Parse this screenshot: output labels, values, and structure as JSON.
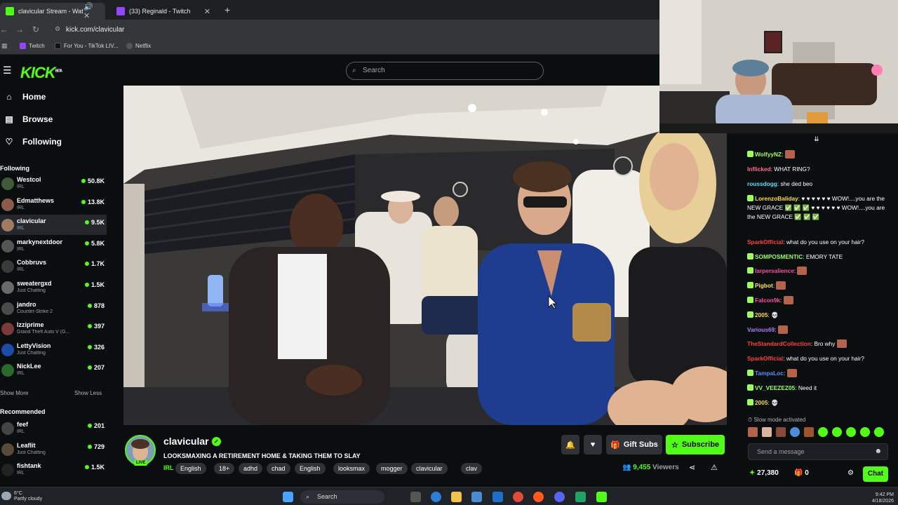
{
  "browser": {
    "tabs": [
      {
        "title": "clavicular Stream - Watch L",
        "color": "#53fc18"
      },
      {
        "title": "(33) Reginald - Twitch",
        "color": "#9146ff"
      }
    ],
    "url": "kick.com/clavicular",
    "bookmarks": [
      {
        "label": "Twitch",
        "color": "#9146ff"
      },
      {
        "label": "For You - TikTok LIV...",
        "color": "#222"
      },
      {
        "label": "Netflix",
        "color": "#666"
      }
    ]
  },
  "kick": {
    "logo": "KICK",
    "logo_sup": "BETA",
    "search_placeholder": "Search"
  },
  "sidebar": {
    "nav": [
      {
        "label": "Home",
        "icon": "home-icon"
      },
      {
        "label": "Browse",
        "icon": "browse-icon"
      },
      {
        "label": "Following",
        "icon": "heart-icon"
      }
    ],
    "following_heading": "Following",
    "following": [
      {
        "name": "Westcol",
        "category": "IRL",
        "viewers": "50.8K",
        "color": "#3e5c3a"
      },
      {
        "name": "Edmatthews",
        "category": "IRL",
        "viewers": "13.8K",
        "color": "#8a5a4a"
      },
      {
        "name": "clavicular",
        "category": "IRL",
        "viewers": "9.5K",
        "color": "#a07b62"
      },
      {
        "name": "markynextdoor",
        "category": "IRL",
        "viewers": "5.8K",
        "color": "#555"
      },
      {
        "name": "Cobbruvs",
        "category": "IRL",
        "viewers": "1.7K",
        "color": "#3a3a3a"
      },
      {
        "name": "sweatergxd",
        "category": "Just Chatting",
        "viewers": "1.5K",
        "color": "#6a6a6a"
      },
      {
        "name": "jandro",
        "category": "Counter-Strike 2",
        "viewers": "878",
        "color": "#4a4a4a"
      },
      {
        "name": "Izziprime",
        "category": "Grand Theft Auto V (G...",
        "viewers": "397",
        "color": "#7a3a3a"
      },
      {
        "name": "LettyVision",
        "category": "Just Chatting",
        "viewers": "326",
        "color": "#1f4aa8"
      },
      {
        "name": "NickLee",
        "category": "IRL",
        "viewers": "207",
        "color": "#2a6a2a"
      }
    ],
    "show_more": "Show More",
    "show_less": "Show Less",
    "recommended_heading": "Recommended",
    "recommended": [
      {
        "name": "feef",
        "category": "IRL",
        "viewers": "201",
        "color": "#444"
      },
      {
        "name": "Leaflit",
        "category": "Just Chatting",
        "viewers": "729",
        "color": "#5a4a3a"
      },
      {
        "name": "fishtank",
        "category": "IRL",
        "viewers": "1.5K",
        "color": "#222"
      }
    ]
  },
  "stream": {
    "streamer": "clavicular",
    "live_label": "LIVE",
    "title": "LOOKSMAXING A RETIREMENT HOME & TAKING THEM TO SLAY",
    "category": "IRL",
    "tags": [
      "English",
      "18+",
      "adhd",
      "chad",
      "English",
      "looksmax",
      "mogger",
      "clavicular",
      "clav"
    ],
    "gift_subs": "Gift Subs",
    "subscribe": "Subscribe",
    "viewers": "9,455",
    "viewers_label": "Viewers"
  },
  "chat": {
    "messages": [
      {
        "user": "WolfyyNZ",
        "color": "#9dff5c",
        "text": "",
        "emote": true
      },
      {
        "user": "Inflicked",
        "color": "#ff6b8a",
        "text": "WHAT RING?"
      },
      {
        "user": "roussdogg",
        "color": "#5ce1ff",
        "text": "she ded beo"
      },
      {
        "user": "LorenzoBaliday",
        "color": "#ffd94a",
        "text": "♥ ♥ ♥ ♥ ♥ ♥ WOW!....you are the NEW GRACE ✅ ✅ ✅ ♥ ♥ ♥ ♥ ♥ ♥ WOW!....you are the NEW GRACE ✅ ✅ ✅"
      },
      {
        "user": "SparkOfficial",
        "color": "#ff4040",
        "text": "what do you use on your hair?"
      },
      {
        "user": "SOMPOSMENTIC",
        "color": "#9dff5c",
        "text": "EMORY TATE"
      },
      {
        "user": "larpersalience",
        "color": "#ff4aa0",
        "text": "",
        "emote": true
      },
      {
        "user": "Pigbot",
        "color": "#ffe066",
        "text": "",
        "emote": true
      },
      {
        "user": "Falcon9k",
        "color": "#ff4aa0",
        "text": "",
        "emote": true
      },
      {
        "user": "2005",
        "color": "#ffd94a",
        "text": "💀"
      },
      {
        "user": "Various69",
        "color": "#b07cff",
        "text": "",
        "emote": true
      },
      {
        "user": "TheStandardCollection",
        "color": "#ff4040",
        "text": "Bro why",
        "emote": true
      },
      {
        "user": "SparkOfficial",
        "color": "#ff4040",
        "text": "what do you use on your hair?"
      },
      {
        "user": "TampaLoc",
        "color": "#5c8aff",
        "text": "",
        "emote": true
      },
      {
        "user": "VV_VEEZEZ05",
        "color": "#9dff5c",
        "text": "Need it"
      },
      {
        "user": "2005",
        "color": "#ffd94a",
        "text": "💀"
      }
    ],
    "slow_mode": "Slow mode activated",
    "input_placeholder": "Send a message",
    "points": "27,380",
    "gifts": "0",
    "send_label": "Chat"
  },
  "taskbar": {
    "temp": "6°C",
    "weather": "Partly cloudy",
    "search": "Search",
    "time": "9:42 PM",
    "date": "4/18/2026"
  }
}
